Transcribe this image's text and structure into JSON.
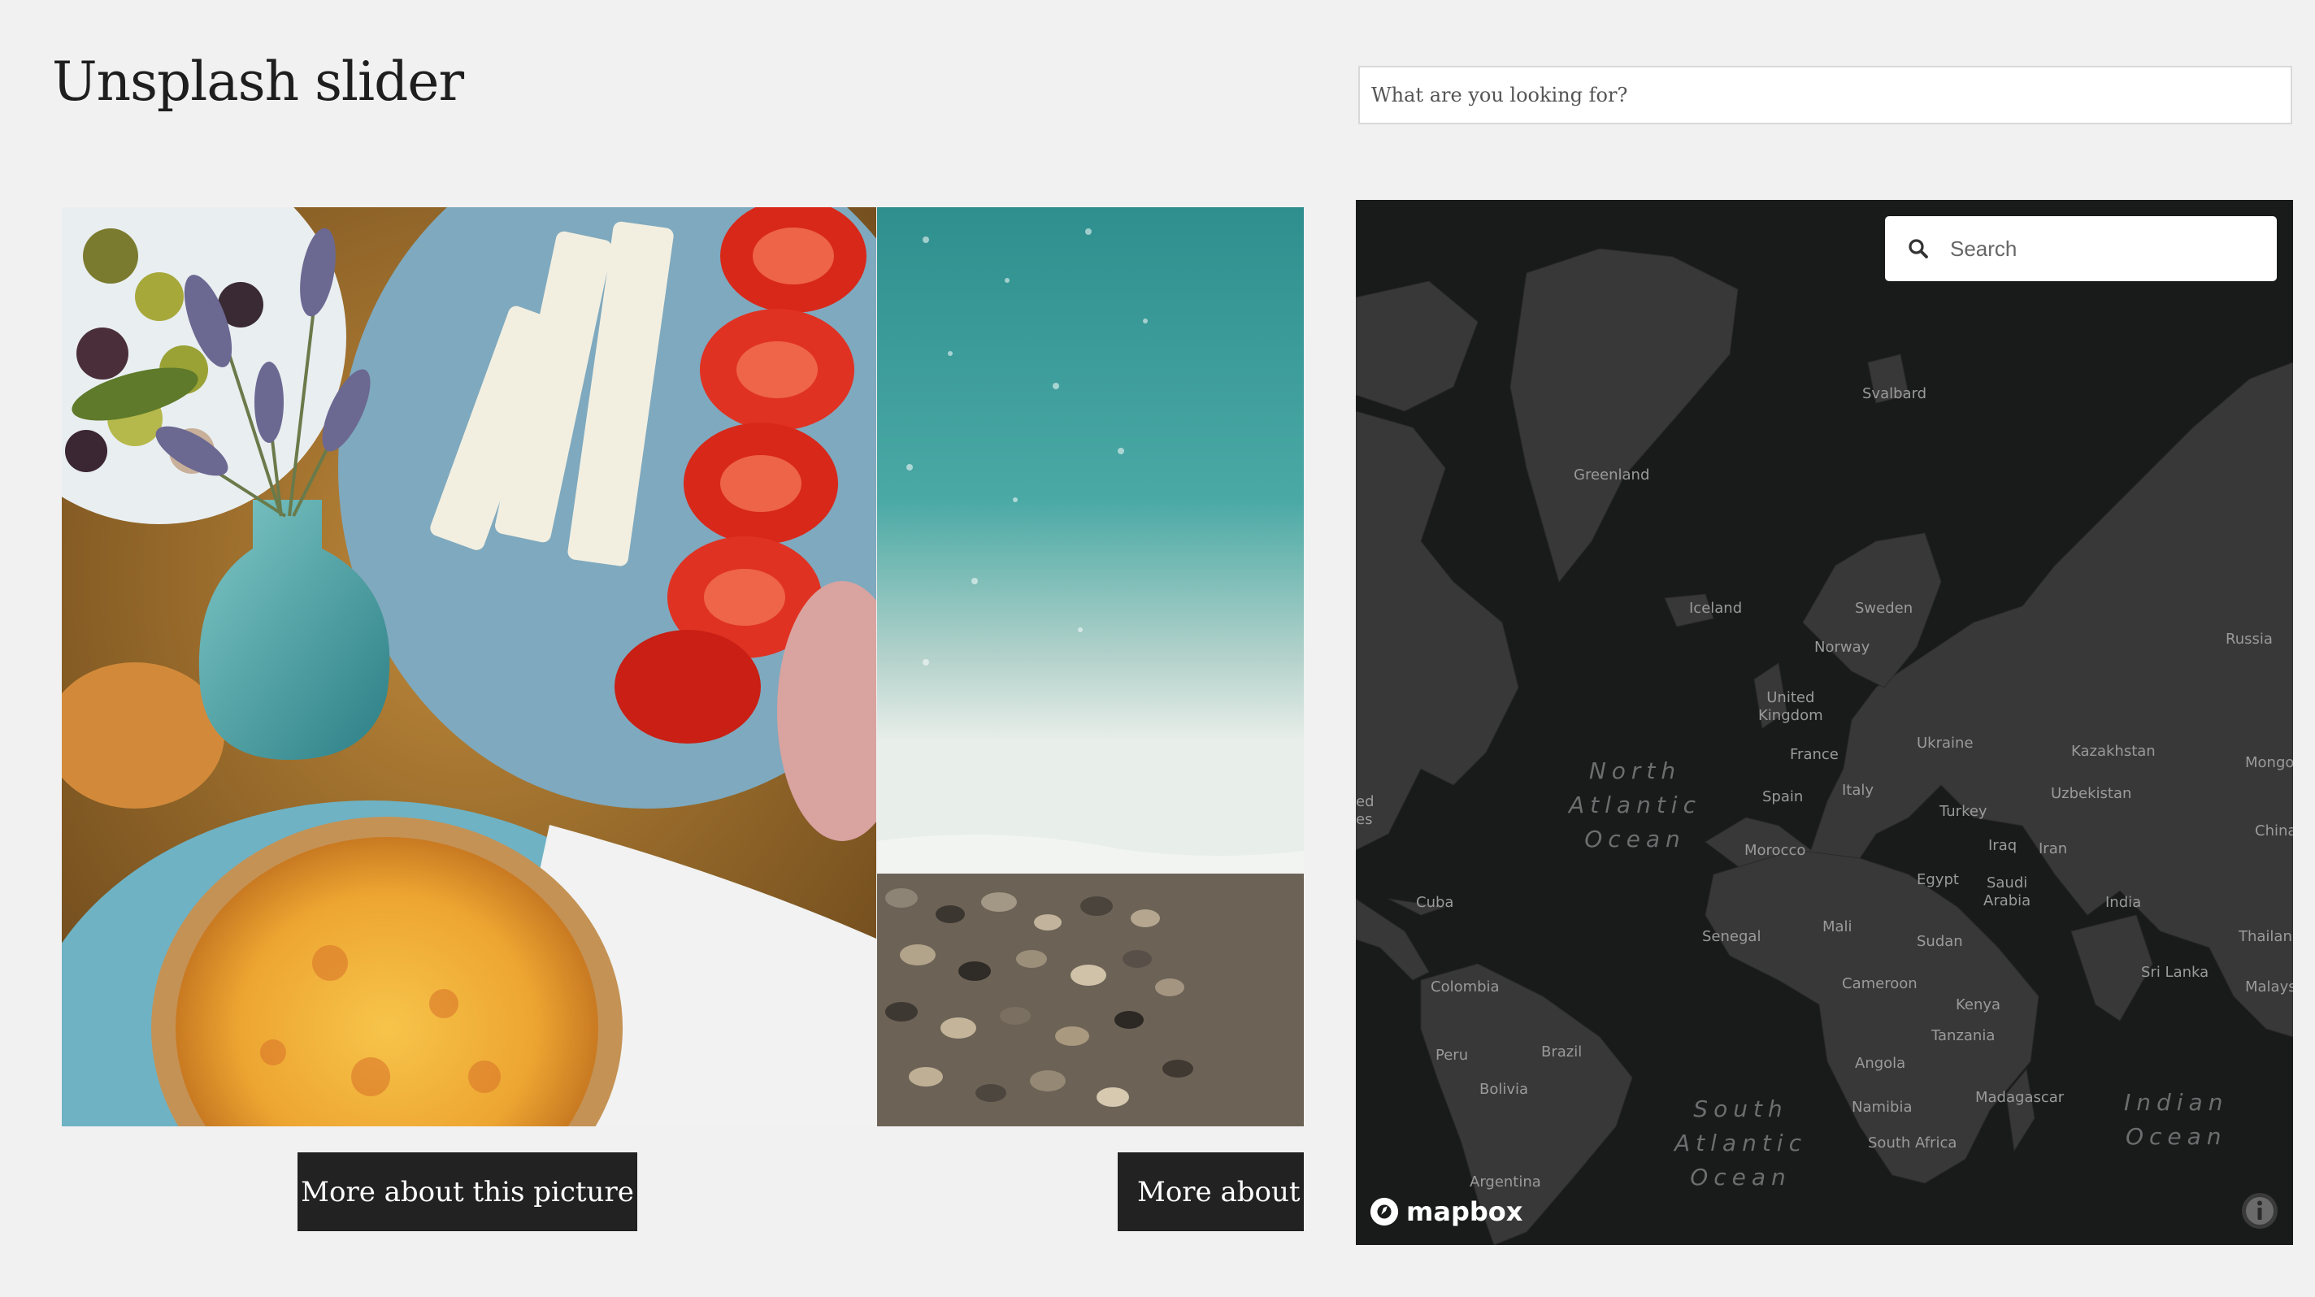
{
  "page": {
    "title": "Unsplash slider"
  },
  "search": {
    "placeholder": "What are you looking for?"
  },
  "slider": {
    "slides": [
      {
        "button_label": "More about this picture",
        "photo_icon": "food-platter-photo"
      },
      {
        "button_label": "More about this picture",
        "photo_icon": "sea-pebbles-photo"
      }
    ]
  },
  "map": {
    "search_placeholder": "Search",
    "attribution": "mapbox",
    "labels": {
      "svalbard": "Svalbard",
      "greenland": "Greenland",
      "iceland": "Iceland",
      "sweden": "Sweden",
      "norway": "Norway",
      "russia": "Russia",
      "united_kingdom": "United\nKingdom",
      "ukraine": "Ukraine",
      "kazakhstan": "Kazakhstan",
      "france": "France",
      "mongolia": "Mongo",
      "spain": "Spain",
      "italy": "Italy",
      "uzbekistan": "Uzbekistan",
      "turkey": "Turkey",
      "china": "China",
      "iraq": "Iraq",
      "iran": "Iran",
      "morocco": "Morocco",
      "egypt": "Egypt",
      "saudi_arabia": "Saudi\nArabia",
      "india": "India",
      "cuba": "Cuba",
      "thailand": "Thailan",
      "senegal": "Senegal",
      "mali": "Mali",
      "sudan": "Sudan",
      "sri_lanka": "Sri Lanka",
      "malaysia": "Malays",
      "colombia": "Colombia",
      "cameroon": "Cameroon",
      "kenya": "Kenya",
      "peru": "Peru",
      "brazil": "Brazil",
      "tanzania": "Tanzania",
      "angola": "Angola",
      "bolivia": "Bolivia",
      "madagascar": "Madagascar",
      "namibia": "Namibia",
      "south_africa": "South Africa",
      "argentina": "Argentina",
      "edge_partial": "ed\nes"
    },
    "oceans": {
      "north_atlantic": "North\nAtlantic\nOcean",
      "south_atlantic": "South\nAtlantic\nOcean",
      "indian": "Indian\nOcean"
    }
  },
  "colors": {
    "page_bg": "#f1f1f1",
    "button_bg": "#222222",
    "map_water": "#191a1a",
    "map_land": "#383838"
  }
}
